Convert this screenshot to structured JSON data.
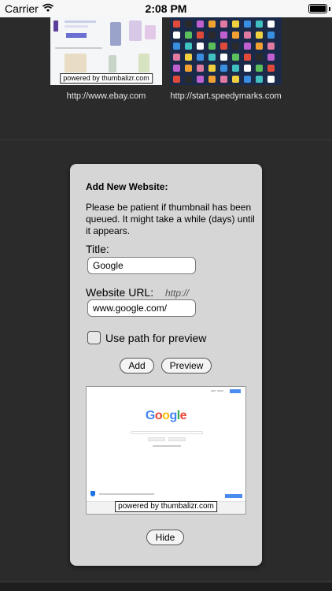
{
  "status_bar": {
    "carrier": "Carrier",
    "time": "2:08 PM"
  },
  "thumbnails": [
    {
      "caption": "http://www.ebay.com",
      "powered": "powered by thumbalizr.com"
    },
    {
      "caption": "http://start.speedymarks.com"
    }
  ],
  "dialog": {
    "heading": "Add New Website:",
    "message": "Please be patient if thumbnail has been queued. It might take a while (days) until it appears.",
    "title_label": "Title:",
    "title_value": "Google",
    "url_label": "Website URL:",
    "url_hint": "http://",
    "url_value": "www.google.com/",
    "checkbox_label": "Use path for preview",
    "add_label": "Add",
    "preview_label": "Preview",
    "hide_label": "Hide",
    "preview_logo": "Google",
    "preview_powered": "powered by thumbalizr.com"
  },
  "colors": {
    "background": "#2b2b2b",
    "dialog": "#d6d6d6",
    "google_blue": "#4285f4",
    "google_red": "#ea4335",
    "google_yellow": "#fbbc05",
    "google_green": "#34a853"
  }
}
